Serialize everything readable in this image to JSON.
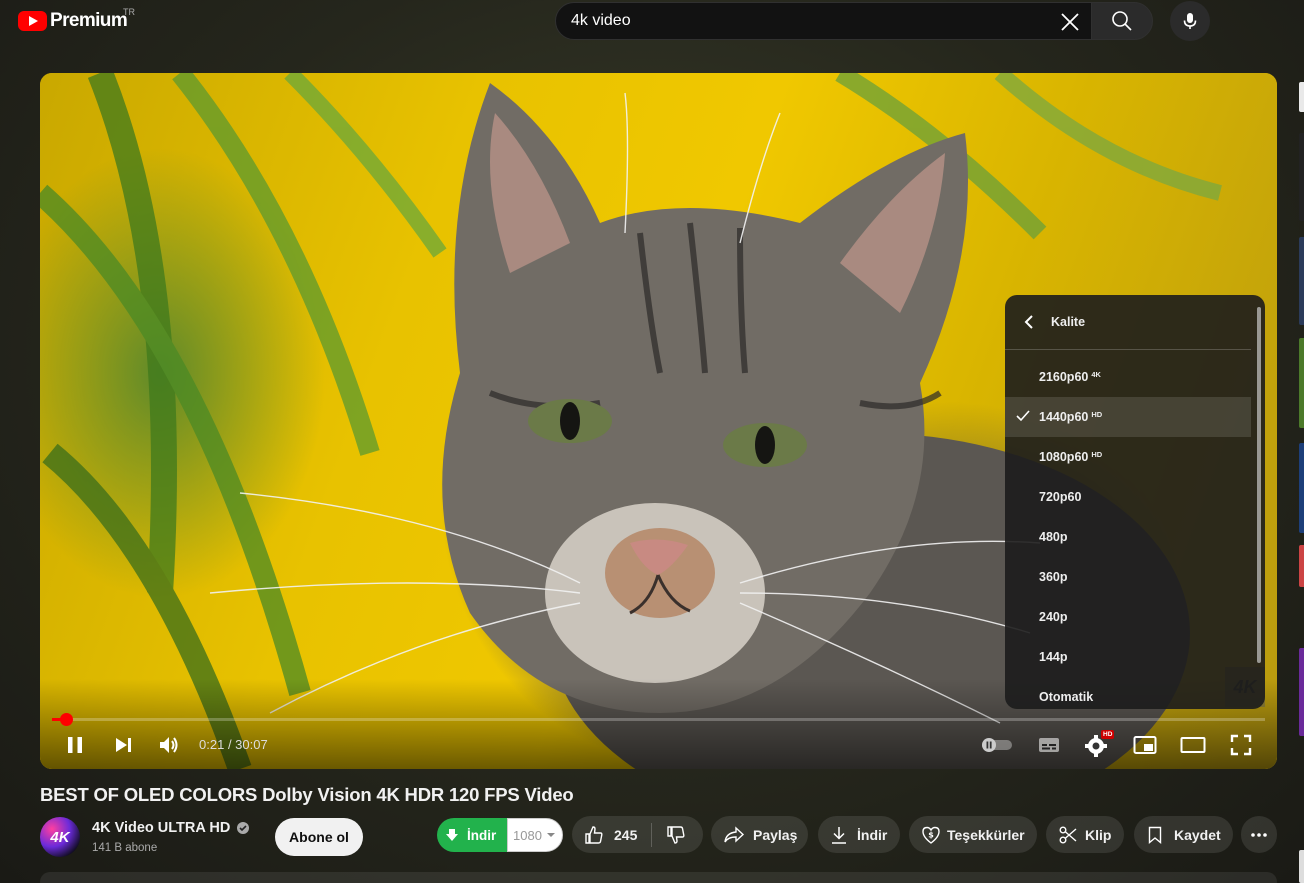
{
  "brand": {
    "name": "Premium",
    "country": "TR"
  },
  "search": {
    "query": "4k video"
  },
  "player": {
    "time_current": "0:21",
    "time_total": "30:07",
    "progress_fraction": 0.0116,
    "settings_badge": "HD",
    "quality_menu": {
      "title": "Kalite",
      "options": [
        {
          "label": "2160p60",
          "badge": "4K",
          "selected": false
        },
        {
          "label": "1440p60",
          "badge": "HD",
          "selected": true
        },
        {
          "label": "1080p60",
          "badge": "HD",
          "selected": false
        },
        {
          "label": "720p60",
          "badge": "",
          "selected": false
        },
        {
          "label": "480p",
          "badge": "",
          "selected": false
        },
        {
          "label": "360p",
          "badge": "",
          "selected": false
        },
        {
          "label": "240p",
          "badge": "",
          "selected": false
        },
        {
          "label": "144p",
          "badge": "",
          "selected": false
        },
        {
          "label": "Otomatik",
          "badge": "",
          "selected": false
        }
      ]
    },
    "watermark": "4K"
  },
  "video": {
    "title": "BEST OF OLED COLORS Dolby Vision 4K HDR 120 FPS Video",
    "channel_name": "4K Video ULTRA HD",
    "channel_avatar_text": "4K",
    "subscribers": "141 B abone",
    "subscribe_label": "Abone ol"
  },
  "actions": {
    "download_green_label": "İndir",
    "download_quality": "1080",
    "like_count": "245",
    "share_label": "Paylaş",
    "download_label": "İndir",
    "thanks_label": "Teşekkürler",
    "clip_label": "Klip",
    "save_label": "Kaydet"
  },
  "colors": {
    "accent_red": "#ff0000",
    "download_green": "#22b24c"
  }
}
